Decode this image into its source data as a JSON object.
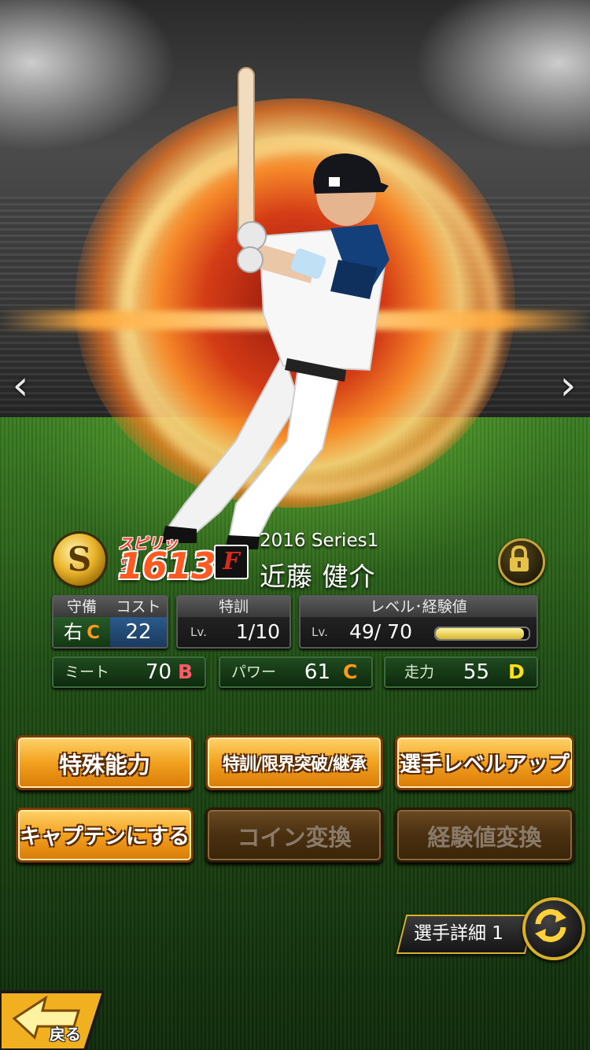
{
  "nav": {
    "prev_icon": "chevron-left-icon",
    "next_icon": "chevron-right-icon",
    "prev_glyph": "‹",
    "next_glyph": "›"
  },
  "card": {
    "rank_letter": "S",
    "spirits_label": "スピリッツ",
    "spirits_value": "1613",
    "team_logo": "F",
    "series": "2016 Series1",
    "player_name": "近藤 健介",
    "locked": true
  },
  "stats": {
    "position_header": "守備",
    "position_value": "右",
    "position_grade": "C",
    "cost_header": "コスト",
    "cost_value": "22",
    "training_header": "特訓",
    "training_lv_label": "Lv.",
    "training_value": "1/10",
    "level_header": "レベル･経験値",
    "level_lv_label": "Lv.",
    "level_value": "49/ 70",
    "exp_fill_percent": 95,
    "meet_label": "ミート",
    "meet_value": "70",
    "meet_grade": "B",
    "power_label": "パワー",
    "power_value": "61",
    "power_grade": "C",
    "speed_label": "走力",
    "speed_value": "55",
    "speed_grade": "D"
  },
  "buttons": {
    "special_ability": "特殊能力",
    "training_break": "特訓/限界突破/継承",
    "level_up": "選手レベルアップ",
    "make_captain": "キャプテンにする",
    "coin_exchange": "コイン変換",
    "exp_exchange": "経験値変換"
  },
  "bottom": {
    "detail_label": "選手詳細 1",
    "back_label": "戻る"
  },
  "colors": {
    "button_active": "#f2a11e",
    "button_disabled": "#4a3010",
    "grade_c": "#ff9a1a",
    "grade_b": "#ff5a6a",
    "grade_d": "#ffe01a"
  }
}
